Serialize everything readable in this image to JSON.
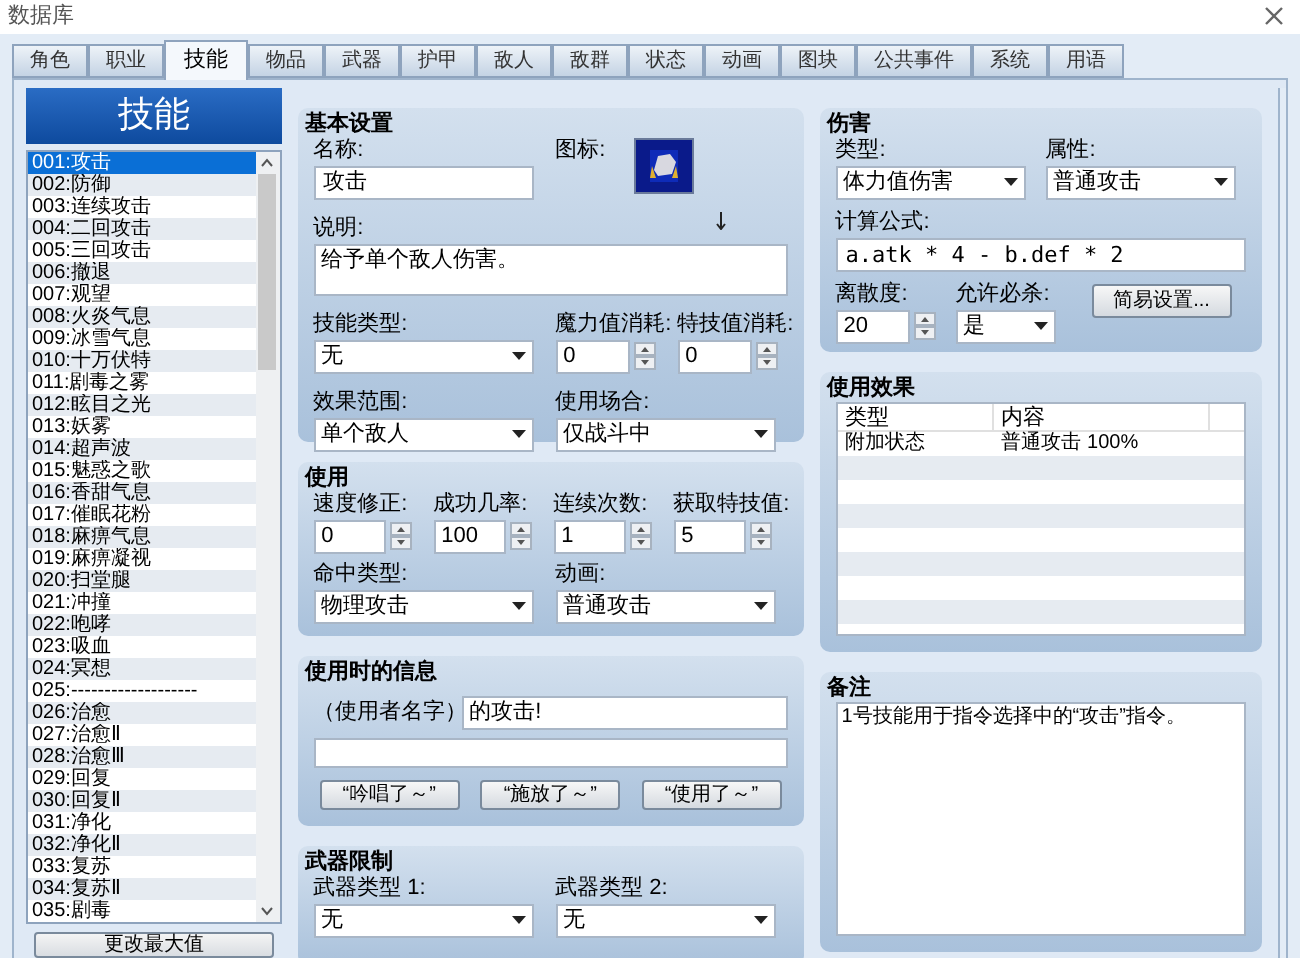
{
  "window": {
    "title": "数据库"
  },
  "tabs": [
    {
      "label": "角色",
      "selected": false
    },
    {
      "label": "职业",
      "selected": false
    },
    {
      "label": "技能",
      "selected": true
    },
    {
      "label": "物品",
      "selected": false
    },
    {
      "label": "武器",
      "selected": false
    },
    {
      "label": "护甲",
      "selected": false
    },
    {
      "label": "敌人",
      "selected": false
    },
    {
      "label": "敌群",
      "selected": false
    },
    {
      "label": "状态",
      "selected": false
    },
    {
      "label": "动画",
      "selected": false
    },
    {
      "label": "图块",
      "selected": false
    },
    {
      "label": "公共事件",
      "selected": false
    },
    {
      "label": "系统",
      "selected": false
    },
    {
      "label": "用语",
      "selected": false
    }
  ],
  "skill_list": {
    "header": "技能",
    "button": "更改最大值",
    "items": [
      {
        "label": "001:攻击",
        "selected": true
      },
      {
        "label": "002:防御",
        "selected": false
      },
      {
        "label": "003:连续攻击",
        "selected": false
      },
      {
        "label": "004:二回攻击",
        "selected": false
      },
      {
        "label": "005:三回攻击",
        "selected": false
      },
      {
        "label": "006:撤退",
        "selected": false
      },
      {
        "label": "007:观望",
        "selected": false
      },
      {
        "label": "008:火炎气息",
        "selected": false
      },
      {
        "label": "009:冰雪气息",
        "selected": false
      },
      {
        "label": "010:十万伏特",
        "selected": false
      },
      {
        "label": "011:剧毒之雾",
        "selected": false
      },
      {
        "label": "012:眩目之光",
        "selected": false
      },
      {
        "label": "013:妖雾",
        "selected": false
      },
      {
        "label": "014:超声波",
        "selected": false
      },
      {
        "label": "015:魅惑之歌",
        "selected": false
      },
      {
        "label": "016:香甜气息",
        "selected": false
      },
      {
        "label": "017:催眠花粉",
        "selected": false
      },
      {
        "label": "018:麻痹气息",
        "selected": false
      },
      {
        "label": "019:麻痹凝视",
        "selected": false
      },
      {
        "label": "020:扫堂腿",
        "selected": false
      },
      {
        "label": "021:冲撞",
        "selected": false
      },
      {
        "label": "022:咆哮",
        "selected": false
      },
      {
        "label": "023:吸血",
        "selected": false
      },
      {
        "label": "024:冥想",
        "selected": false
      },
      {
        "label": "025:-------------------",
        "selected": false
      },
      {
        "label": "026:治愈",
        "selected": false
      },
      {
        "label": "027:治愈Ⅱ",
        "selected": false
      },
      {
        "label": "028:治愈Ⅲ",
        "selected": false
      },
      {
        "label": "029:回复",
        "selected": false
      },
      {
        "label": "030:回复Ⅱ",
        "selected": false
      },
      {
        "label": "031:净化",
        "selected": false
      },
      {
        "label": "032:净化Ⅱ",
        "selected": false
      },
      {
        "label": "033:复苏",
        "selected": false
      },
      {
        "label": "034:复苏Ⅱ",
        "selected": false
      },
      {
        "label": "035:剧毒",
        "selected": false
      }
    ]
  },
  "basic_settings": {
    "title": "基本设置",
    "icon_label": "图标:",
    "fields": [
      {
        "kind": "text",
        "label": "名称:",
        "value": "攻击"
      },
      {
        "kind": "textarea",
        "label": "说明:",
        "value": "给予单个敌人伤害。"
      },
      {
        "kind": "select",
        "label": "技能类型:",
        "value": "无"
      },
      {
        "kind": "spin",
        "label": "魔力值消耗:",
        "value": "0"
      },
      {
        "kind": "spin",
        "label": "特技值消耗:",
        "value": "0"
      },
      {
        "kind": "select",
        "label": "效果范围:",
        "value": "单个敌人"
      },
      {
        "kind": "select",
        "label": "使用场合:",
        "value": "仅战斗中"
      }
    ]
  },
  "invocation": {
    "title": "使用",
    "fields": [
      {
        "kind": "spin",
        "label": "速度修正:",
        "value": "0"
      },
      {
        "kind": "spin",
        "label": "成功几率:",
        "value": "100"
      },
      {
        "kind": "spin",
        "label": "连续次数:",
        "value": "1"
      },
      {
        "kind": "spin",
        "label": "获取特技值:",
        "value": "5"
      },
      {
        "kind": "select",
        "label": "命中类型:",
        "value": "物理攻击"
      },
      {
        "kind": "select",
        "label": "动画:",
        "value": "普通攻击"
      }
    ]
  },
  "message": {
    "title": "使用时的信息",
    "prefix": "（使用者名字）",
    "line_1": "的攻击!",
    "buttons": [
      "“吟唱了～”",
      "“施放了～”",
      "“使用了～”"
    ]
  },
  "weapon_requirements": {
    "title": "武器限制",
    "fields": [
      {
        "kind": "select",
        "label": "武器类型 1:",
        "value": "无"
      },
      {
        "kind": "select",
        "label": "武器类型 2:",
        "value": "无"
      }
    ]
  },
  "damage": {
    "title": "伤害",
    "button": "简易设置...",
    "fields": [
      {
        "kind": "select",
        "label": "类型:",
        "value": "体力值伤害"
      },
      {
        "kind": "select",
        "label": "属性:",
        "value": "普通攻击"
      },
      {
        "kind": "text",
        "label": "计算公式:",
        "value": "a.atk * 4 - b.def * 2"
      },
      {
        "kind": "spin",
        "label": "离散度:",
        "value": "20"
      },
      {
        "kind": "select",
        "label": "允许必杀:",
        "value": "是"
      }
    ]
  },
  "effects": {
    "title": "使用效果",
    "columns": [
      "类型",
      "内容"
    ],
    "rows": [
      [
        "附加状态",
        "普通攻击 100%"
      ]
    ]
  },
  "note": {
    "title": "备注",
    "value": "1号技能用于指令选择中的“攻击”指令。"
  }
}
